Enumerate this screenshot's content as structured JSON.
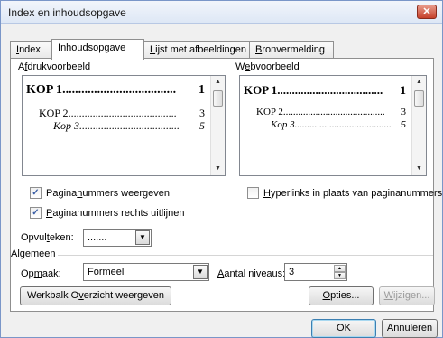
{
  "window": {
    "title": "Index en inhoudsopgave",
    "close_glyph": "✕"
  },
  "tabs": [
    {
      "pre": "",
      "u": "I",
      "post": "ndex"
    },
    {
      "pre": "",
      "u": "I",
      "post": "nhoudsopgave"
    },
    {
      "pre": "",
      "u": "L",
      "post": "ijst met afbeeldingen"
    },
    {
      "pre": "",
      "u": "B",
      "post": "ronvermelding"
    }
  ],
  "print_preview": {
    "label_pre": "A",
    "label_u": "f",
    "label_post": "drukvoorbeeld",
    "entries": [
      {
        "text": "KOP 1",
        "page": "1"
      },
      {
        "text": "KOP 2",
        "page": "3"
      },
      {
        "text": "Kop 3",
        "page": "5"
      }
    ]
  },
  "web_preview": {
    "label_pre": "W",
    "label_u": "e",
    "label_post": "bvoorbeeld",
    "entries": [
      {
        "text": "KOP 1",
        "page": "1"
      },
      {
        "text": "KOP 2",
        "page": "3"
      },
      {
        "text": "Kop 3",
        "page": "5"
      }
    ]
  },
  "options": {
    "show_page_numbers": {
      "pre": "Pagina",
      "u": "n",
      "post": "ummers weergeven",
      "checked": true
    },
    "right_align": {
      "pre": "",
      "u": "P",
      "post": "aginanummers rechts uitlijnen",
      "checked": true
    },
    "hyperlinks": {
      "pre": "",
      "u": "H",
      "post": "yperlinks in plaats van paginanummers",
      "checked": false
    },
    "tab_leader": {
      "label_pre": "Opvul",
      "label_u": "t",
      "label_post": "eken:",
      "value": "......."
    }
  },
  "general": {
    "label": "Algemeen",
    "format": {
      "label_pre": "Op",
      "label_u": "m",
      "label_post": "aak:",
      "value": "Formeel"
    },
    "levels": {
      "label_pre": "",
      "label_u": "A",
      "label_post": "antal niveaus:",
      "value": "3"
    }
  },
  "buttons": {
    "outline_toolbar": {
      "pre": "Werkbalk O",
      "u": "v",
      "post": "erzicht weergeven"
    },
    "options": {
      "pre": "",
      "u": "O",
      "post": "pties..."
    },
    "modify": {
      "pre": "",
      "u": "W",
      "post": "ijzigen..."
    },
    "ok": "OK",
    "cancel": "Annuleren"
  },
  "icons": {
    "check": "✓",
    "dropdown": "▼",
    "up": "▲",
    "down": "▼"
  }
}
